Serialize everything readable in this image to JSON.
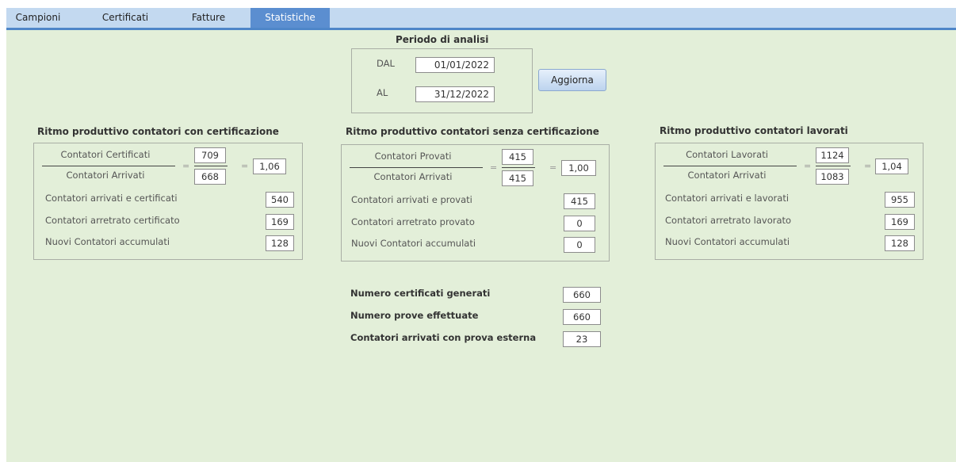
{
  "tabs": [
    "Campioni",
    "Certificati",
    "Fatture",
    "Statistiche"
  ],
  "period": {
    "title": "Periodo di analisi",
    "from_label": "DAL",
    "from_value": "01/01/2022",
    "to_label": "AL",
    "to_value": "31/12/2022",
    "refresh_button": "Aggiorna"
  },
  "cert": {
    "title": "Ritmo produttivo contatori con certificazione",
    "num_label": "Contatori Certificati",
    "num_value": "709",
    "den_label": "Contatori Arrivati",
    "den_value": "668",
    "eq": "=",
    "ratio": "1,06",
    "rows": [
      {
        "label": "Contatori arrivati e certificati",
        "value": "540"
      },
      {
        "label": "Contatori arretrato certificato",
        "value": "169"
      },
      {
        "label": "Nuovi Contatori accumulati",
        "value": "128"
      }
    ]
  },
  "nocert": {
    "title": "Ritmo produttivo contatori senza certificazione",
    "num_label": "Contatori Provati",
    "num_value": "415",
    "den_label": "Contatori Arrivati",
    "den_value": "415",
    "eq": "=",
    "ratio": "1,00",
    "rows": [
      {
        "label": "Contatori arrivati e provati",
        "value": "415"
      },
      {
        "label": "Contatori arretrato provato",
        "value": "0"
      },
      {
        "label": "Nuovi Contatori accumulati",
        "value": "0"
      }
    ]
  },
  "worked": {
    "title": "Ritmo produttivo contatori lavorati",
    "num_label": "Contatori Lavorati",
    "num_value": "1124",
    "den_label": "Contatori Arrivati",
    "den_value": "1083",
    "eq": "=",
    "ratio": "1,04",
    "rows": [
      {
        "label": "Contatori arrivati e lavorati",
        "value": "955"
      },
      {
        "label": "Contatori arretrato lavorato",
        "value": "169"
      },
      {
        "label": "Nuovi Contatori accumulati",
        "value": "128"
      }
    ]
  },
  "totals": [
    {
      "label": "Numero certificati generati",
      "value": "660"
    },
    {
      "label": "Numero prove effettuate",
      "value": "660"
    },
    {
      "label": "Contatori arrivati con prova esterna",
      "value": "23"
    }
  ],
  "colors": {
    "tab_bar": "#c3d9f0",
    "tab_active": "#5b8ed0",
    "background": "#e3efd9"
  }
}
